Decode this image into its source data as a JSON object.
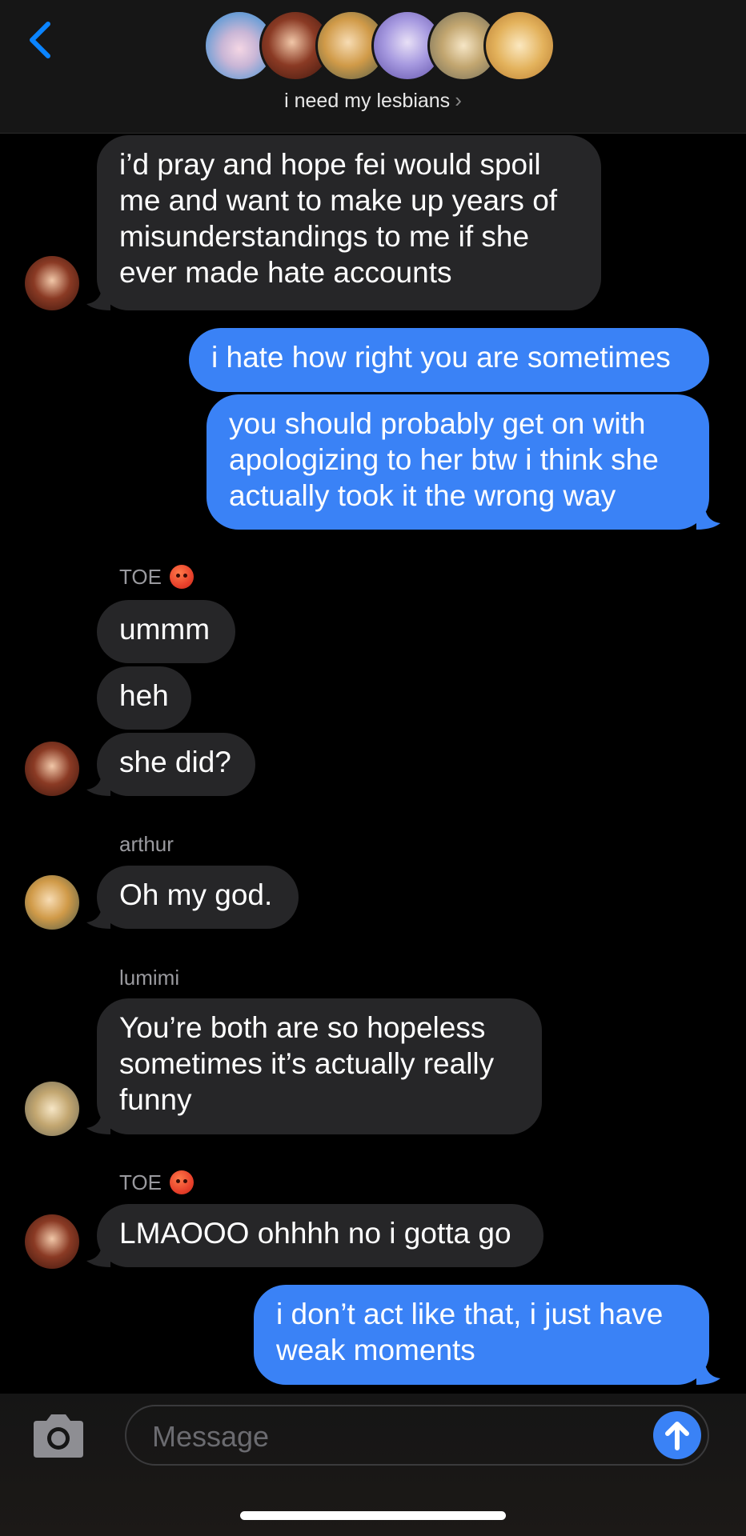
{
  "header": {
    "group_name": "i need my lesbians",
    "chevron": "›",
    "avatars": [
      {
        "name": "plush-avatar",
        "color": "#7aa6d8"
      },
      {
        "name": "member-avatar-2",
        "color": "#6b2a1e"
      },
      {
        "name": "member-avatar-3",
        "color": "#c98a3a"
      },
      {
        "name": "member-avatar-4",
        "color": "#9a8ad0"
      },
      {
        "name": "member-avatar-5",
        "color": "#b8a070"
      },
      {
        "name": "member-avatar-6",
        "color": "#e0b060"
      }
    ]
  },
  "messages": {
    "m1": "i’d pray and hope fei would spoil me and want to make up years of misunderstandings to me if she ever made hate accounts",
    "m2": "i hate how right you are sometimes",
    "m3": "you should probably get on with apologizing to her btw i think she actually took it the wrong way",
    "sender_toe": "TOE",
    "m4": "ummm",
    "m5": "heh",
    "m6": "she did?",
    "sender_arthur": "arthur",
    "m7": "Oh my god.",
    "sender_lumimi": "lumimi",
    "m8": "You’re both are so hopeless sometimes it’s actually really funny",
    "sender_toe2": "TOE",
    "m9": "LMAOOO ohhhh no i gotta go",
    "m10": "i don’t act like that, i just have weak moments"
  },
  "composer": {
    "placeholder": "Message"
  },
  "colors": {
    "accent": "#3a82f6",
    "incoming_bubble": "#262628",
    "background": "#000000",
    "back_chevron": "#0a84ff"
  },
  "icons": {
    "back": "chevron-left-icon",
    "camera": "camera-icon",
    "send": "arrow-up-icon",
    "angry": "angry-face-emoji"
  }
}
